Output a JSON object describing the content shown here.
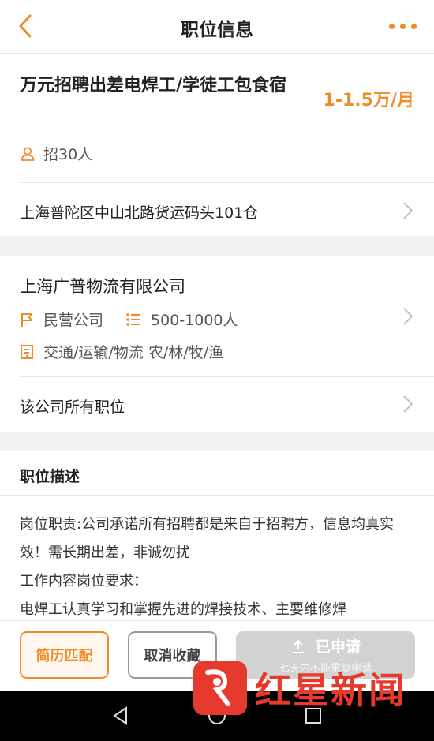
{
  "header": {
    "title": "职位信息"
  },
  "job": {
    "title": "万元招聘出差电焊工/学徒工包食宿",
    "salary": "1-1.5万/月",
    "headcount": "招30人",
    "address": "上海普陀区中山北路货运码头101仓"
  },
  "company": {
    "name": "上海广普物流有限公司",
    "type": "民营公司",
    "size": "500-1000人",
    "industry": "交通/运输/物流 农/林/牧/渔",
    "all_jobs_label": "该公司所有职位"
  },
  "description": {
    "section_title": "职位描述",
    "line1": "岗位职责:公司承诺所有招聘都是来自于招聘方，信息均真实效！需长期出差，非诚勿扰",
    "line2": "工作内容岗位要求：",
    "line3": "电焊工认真学习和掌握先进的焊接技术、主要维修焊"
  },
  "actions": {
    "match_label": "简历匹配",
    "unfavorite_label": "取消收藏",
    "applied_label": "已申请",
    "applied_sub": "七天内不能重复申请"
  },
  "watermark": {
    "text": "红星新闻",
    "logo_text": "红星\n新闻"
  },
  "colors": {
    "accent": "#f08b2a",
    "watermark": "#e63a2e"
  }
}
